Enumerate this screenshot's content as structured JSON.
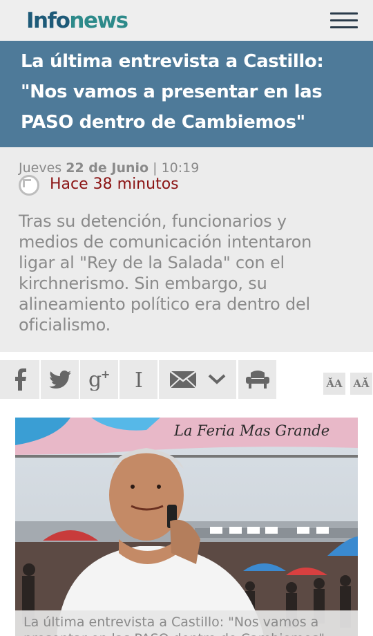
{
  "header": {
    "logo_part1": "Info",
    "logo_part2": "news",
    "menu_icon": "hamburger-menu-icon"
  },
  "article": {
    "title_line1": "La última entrevista a Castillo:",
    "title_line2": "\"Nos vamos a presentar en las",
    "title_line3": "PASO dentro de Cambiemos\"",
    "date_day": "Jueves",
    "date_bold": "22 de Junio",
    "date_time": "| 10:19",
    "time_ago": "Hace 38 minutos",
    "summary": "Tras su detención, funcionarios y medios de comunicación intentaron ligar al \"Rey de la Salada\" con el kirchnerismo. Sin embargo, su alineamiento político era dentro del oficialismo."
  },
  "share": {
    "buttons": [
      {
        "name": "facebook-icon",
        "glyph": "f"
      },
      {
        "name": "twitter-icon",
        "glyph": "🐦"
      },
      {
        "name": "google-plus-icon",
        "glyph": "g+"
      },
      {
        "name": "instapaper-icon",
        "glyph": "I"
      },
      {
        "name": "email-icon",
        "glyph": "✉"
      },
      {
        "name": "more-chevron-icon",
        "glyph": "⌄"
      },
      {
        "name": "reader-mode-icon",
        "glyph": "☕"
      }
    ],
    "font_decrease": "ĂA",
    "font_increase": "AĂ"
  },
  "photo": {
    "banner_text": "La Feria Mas Grande",
    "caption": "La última entrevista a Castillo: \"Nos vamos a presentar en las PASO dentro de Cambiemos\""
  }
}
